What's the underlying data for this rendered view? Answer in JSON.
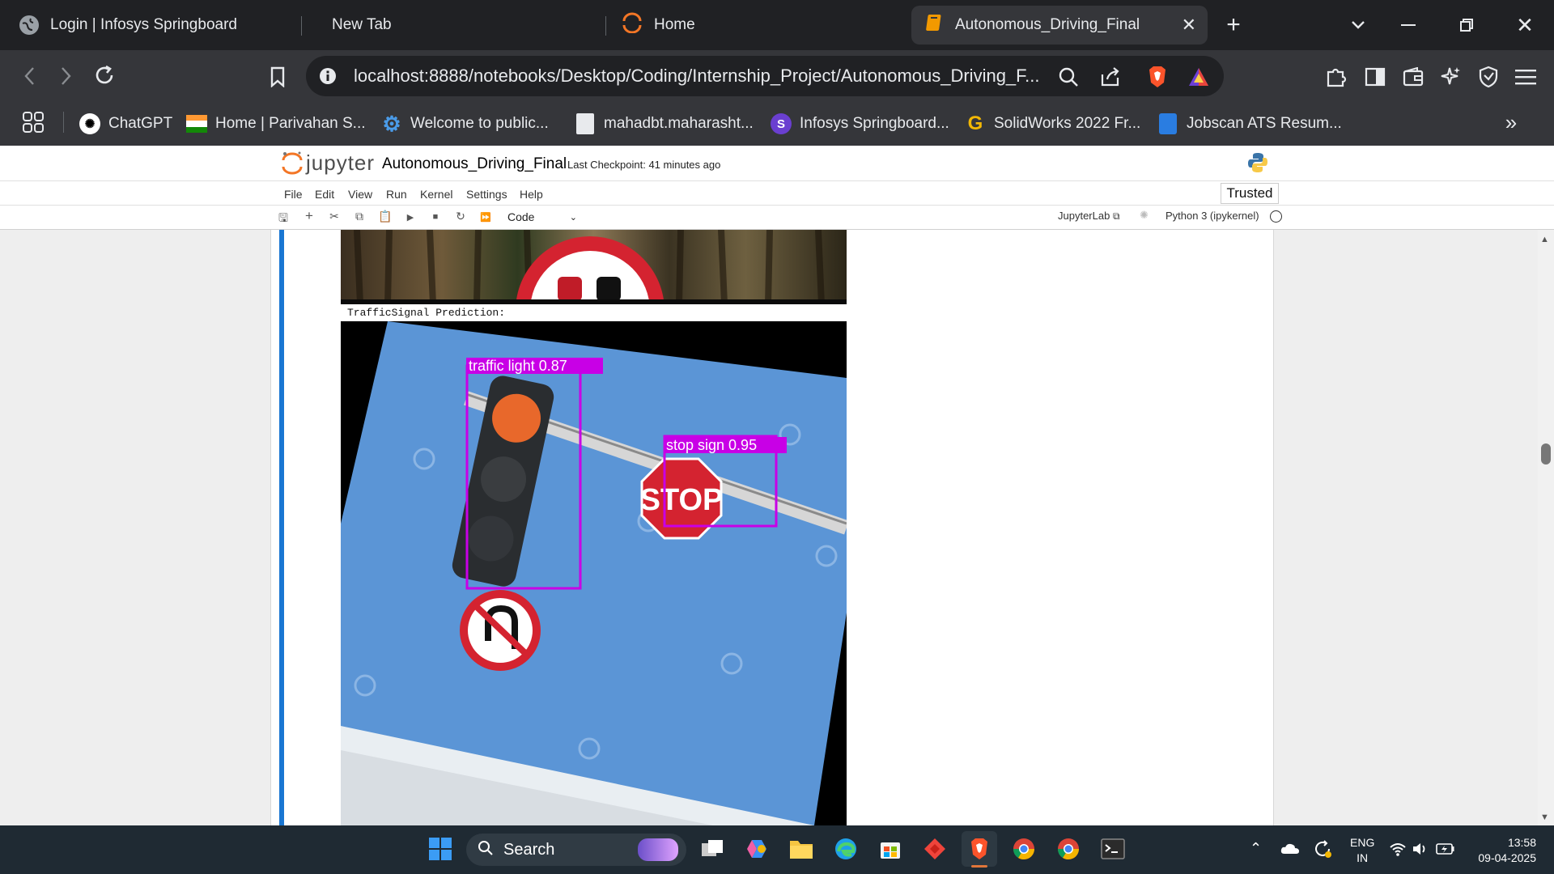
{
  "browser": {
    "tabs": [
      {
        "label": "Login | Infosys Springboard",
        "icon": "globe-icon"
      },
      {
        "label": "New Tab",
        "icon": ""
      },
      {
        "label": "Home",
        "icon": "jupyter-icon"
      },
      {
        "label": "Autonomous_Driving_Final",
        "icon": "notebook-icon",
        "active": true
      }
    ],
    "url": "localhost:8888/notebooks/Desktop/Coding/Internship_Project/Autonomous_Driving_F...",
    "bookmarks": [
      {
        "label": "ChatGPT",
        "icon": "chatgpt-icon"
      },
      {
        "label": "Home | Parivahan S...",
        "icon": "india-flag-icon"
      },
      {
        "label": "Welcome to public...",
        "icon": "gear-icon"
      },
      {
        "label": "mahadbt.maharasht...",
        "icon": "document-icon"
      },
      {
        "label": "Infosys Springboard...",
        "icon": "springboard-icon"
      },
      {
        "label": "SolidWorks 2022 Fr...",
        "icon": "g-icon"
      },
      {
        "label": "Jobscan ATS Resum...",
        "icon": "jobscan-icon"
      }
    ]
  },
  "jupyter": {
    "logo_text": "jupyter",
    "notebook_name": "Autonomous_Driving_Final",
    "checkpoint": "Last Checkpoint: 41 minutes ago",
    "menu": [
      "File",
      "Edit",
      "View",
      "Run",
      "Kernel",
      "Settings",
      "Help"
    ],
    "trusted": "Trusted",
    "cell_type": "Code",
    "jupyterlab_link": "JupyterLab",
    "kernel": "Python 3 (ipykernel)"
  },
  "output": {
    "prediction_label": "TrafficSignal Prediction:",
    "detections": [
      {
        "label": "traffic light 0.87"
      },
      {
        "label": "stop sign 0.95"
      }
    ],
    "stop_text": "STOP"
  },
  "taskbar": {
    "search_placeholder": "Search",
    "lang_top": "ENG",
    "lang_bottom": "IN",
    "time": "13:58",
    "date": "09-04-2025"
  },
  "colors": {
    "detection_box": "#c800e6",
    "cell_active_bar": "#1976d2",
    "tab_active": "#35363a"
  }
}
